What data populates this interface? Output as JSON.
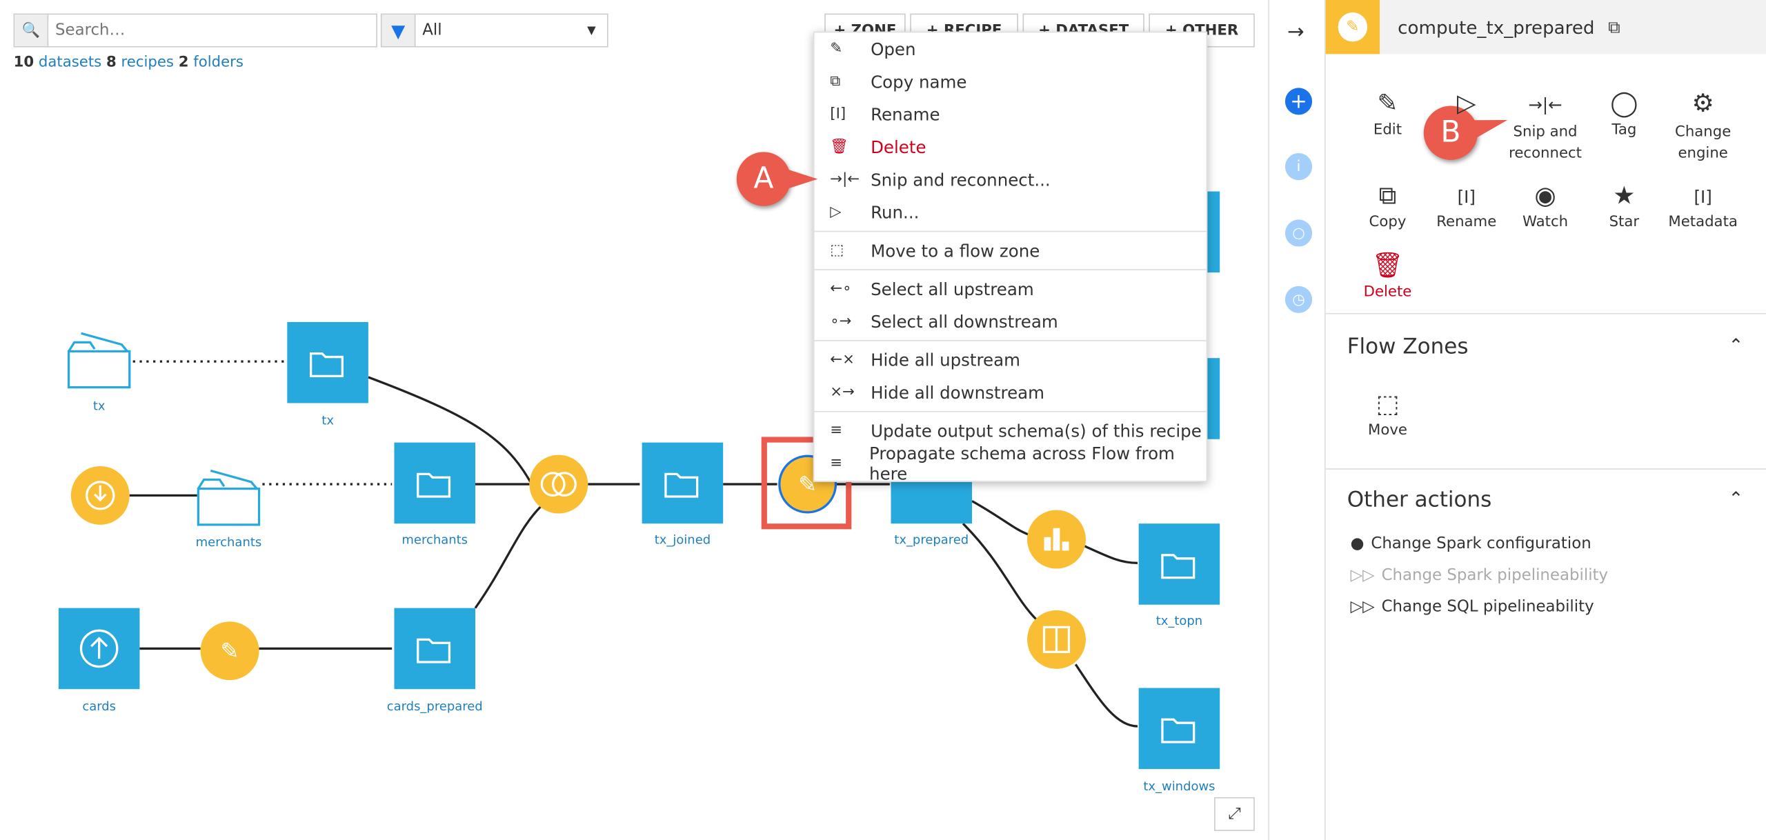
{
  "search": {
    "placeholder": "Search…",
    "filter_value": "All"
  },
  "counts": {
    "datasets_n": "10",
    "datasets": "datasets",
    "recipes_n": "8",
    "recipes": "recipes",
    "folders_n": "2",
    "folders": "folders"
  },
  "toolbar": {
    "zone": "+ ZONE",
    "recipe": "+ RECIPE",
    "dataset": "+ DATASET",
    "other": "+ OTHER"
  },
  "flow": {
    "folder_tx": "tx",
    "ds_tx": "tx",
    "folder_merchants": "merchants",
    "ds_merchants": "merchants",
    "ds_tx_joined": "tx_joined",
    "ds_tx_prepared": "tx_prepared",
    "ds_tx_topn": "tx_topn",
    "ds_tx_windows": "tx_windows",
    "ds_cards": "cards",
    "ds_cards_prepared": "cards_prepared"
  },
  "menu": [
    "Open",
    "Copy name",
    "Rename",
    "Delete",
    "Snip and reconnect...",
    "Run...",
    "Move to a flow zone",
    "Select all upstream",
    "Select all downstream",
    "Hide all upstream",
    "Hide all downstream",
    "Update output schema(s) of this recipe",
    "Propagate schema across Flow from here"
  ],
  "callouts": {
    "a": "A",
    "b": "B"
  },
  "panel": {
    "title": "compute_tx_prepared",
    "actions": [
      "Edit",
      "Snip and\nreconnect",
      "Tag",
      "Change\nengine",
      "Copy",
      "Rename",
      "Watch",
      "Star",
      "Metadata",
      "Delete"
    ],
    "flow_zones": "Flow Zones",
    "move": "Move",
    "other_actions": "Other actions",
    "other": [
      "Change Spark configuration",
      "Change Spark pipelineability",
      "Change SQL pipelineability"
    ]
  },
  "colors": {
    "dataset": "#28a9dd",
    "recipe": "#f9be34",
    "danger": "#d0021b",
    "callout": "#ea5b4d",
    "accent": "#1a73e8"
  }
}
